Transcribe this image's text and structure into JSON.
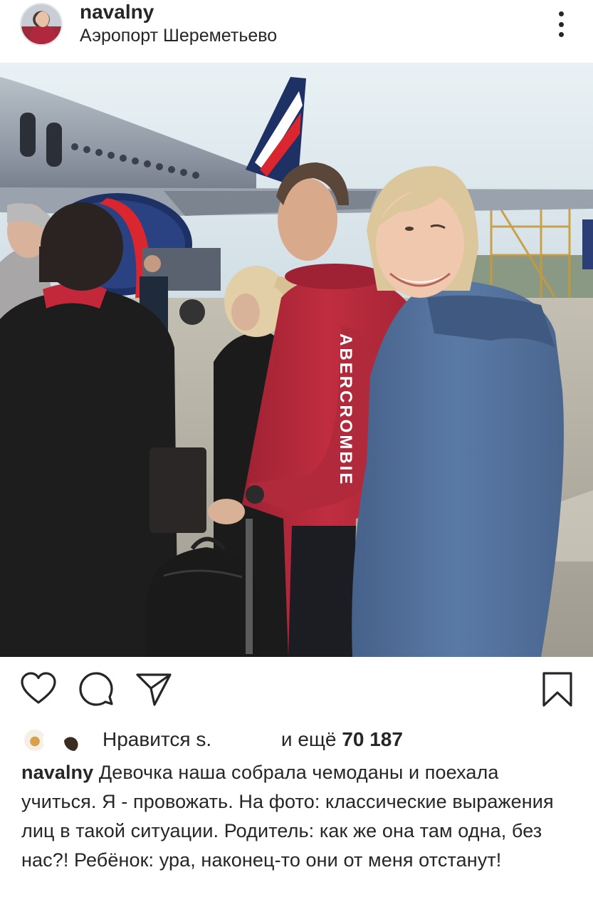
{
  "post": {
    "username": "navalny",
    "location": "Аэропорт Шереметьево",
    "likes_prefix": "Нравится",
    "likes_name_partial": "s.",
    "likes_middle": "и ещё",
    "likes_count": "70 187",
    "caption_author": "navalny",
    "caption_text": "Девочка наша собрала чемоданы и поехала учиться. Я - провожать. На фото: классические выражения лиц в такой ситуации. Родитель: как же она там одна, без нас?! Ребёнок: ура, наконец-то они от меня отстанут!",
    "photo_text": "ABERCROMBIE"
  },
  "icons": {
    "more": "more-vertical-icon",
    "like": "heart-icon",
    "comment": "comment-icon",
    "share": "send-icon",
    "save": "bookmark-icon",
    "tag": "user-tag-icon"
  },
  "colors": {
    "text": "#262626",
    "hoodie_red": "#b8283a",
    "hoodie_blue": "#4f6e98",
    "aeroflot_navy": "#1d3165",
    "aeroflot_red": "#d9262f"
  }
}
